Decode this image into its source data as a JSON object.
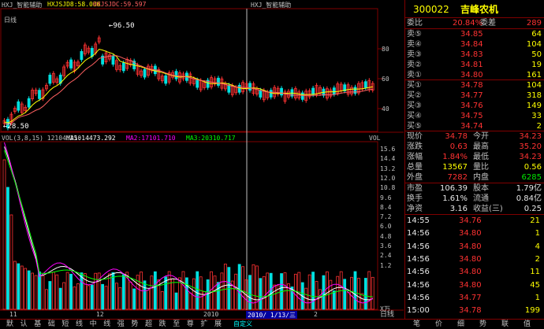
{
  "header": {
    "indicator_name": "HXJ_智能辅助",
    "line1": "HXJSJD8:58.006",
    "line2": "HXJSJDC:59.597",
    "indicator_name_right": "HXJ_智能辅助",
    "period": "日线"
  },
  "colors": {
    "up": "#ff3232",
    "down": "#00e0e0",
    "ma1": "#ffffff",
    "ma2": "#ff00ff",
    "ma3": "#00ff00",
    "grid": "#800000",
    "ma_price1": "#ffff00",
    "ma_price2": "#ff6060"
  },
  "price_chart": {
    "high_label": "96.50",
    "low_label": "28.50",
    "y_ticks": [
      "80",
      "60",
      "40"
    ],
    "cursor_date": "2010/ 1/13/三"
  },
  "volume_chart": {
    "header": "VOL(3,8,15) 12104.250",
    "ma1": "MA1:14473.292",
    "ma2": "MA2:17101.710",
    "ma3": "MA3:20310.717",
    "label_right": "VOL",
    "y_ticks": [
      "15.6",
      "14.4",
      "13.2",
      "12.0",
      "10.8",
      "9.6",
      "8.4",
      "7.2",
      "6.0",
      "4.8",
      "3.6",
      "2.4",
      "1.2"
    ],
    "unit": "X万",
    "x_labels": [
      "11",
      "12",
      "2010",
      "2"
    ],
    "custom_label": "自定义"
  },
  "quote": {
    "code": "300022",
    "name": "吉峰农机",
    "weibi_label": "委比",
    "weibi": "20.84%",
    "weicha_label": "委差",
    "weicha": "289",
    "asks": [
      {
        "label": "卖⑤",
        "price": "34.85",
        "vol": "64"
      },
      {
        "label": "卖④",
        "price": "34.84",
        "vol": "104"
      },
      {
        "label": "卖③",
        "price": "34.83",
        "vol": "50"
      },
      {
        "label": "卖②",
        "price": "34.81",
        "vol": "19"
      },
      {
        "label": "卖①",
        "price": "34.80",
        "vol": "161"
      }
    ],
    "bids": [
      {
        "label": "买①",
        "price": "34.78",
        "vol": "104"
      },
      {
        "label": "买②",
        "price": "34.77",
        "vol": "318"
      },
      {
        "label": "买③",
        "price": "34.76",
        "vol": "149"
      },
      {
        "label": "买④",
        "price": "34.75",
        "vol": "33"
      },
      {
        "label": "买⑤",
        "price": "34.74",
        "vol": "2"
      }
    ],
    "stats": [
      {
        "l1": "现价",
        "v1": "34.78",
        "l2": "今开",
        "v2": "34.23"
      },
      {
        "l1": "涨跌",
        "v1": "0.63",
        "l2": "最高",
        "v2": "35.20"
      },
      {
        "l1": "涨幅",
        "v1": "1.84%",
        "l2": "最低",
        "v2": "34.23"
      },
      {
        "l1": "总量",
        "v1": "13567",
        "l2": "量比",
        "v2": "0.56"
      },
      {
        "l1": "外盘",
        "v1": "7282",
        "l2": "内盘",
        "v2": "6285"
      }
    ],
    "fin": [
      {
        "l1": "市盈",
        "v1": "106.39",
        "l2": "股本",
        "v2": "1.79亿"
      },
      {
        "l1": "换手",
        "v1": "1.61%",
        "l2": "流通",
        "v2": "0.84亿"
      },
      {
        "l1": "净资",
        "v1": "3.16",
        "l2": "收益(三)",
        "v2": "0.25"
      }
    ],
    "ticks": [
      {
        "time": "14:55",
        "price": "34.76",
        "vol": "21"
      },
      {
        "time": "14:56",
        "price": "34.80",
        "vol": "1"
      },
      {
        "time": "14:56",
        "price": "34.80",
        "vol": "4"
      },
      {
        "time": "14:56",
        "price": "34.80",
        "vol": "2"
      },
      {
        "time": "14:56",
        "price": "34.80",
        "vol": "11"
      },
      {
        "time": "14:56",
        "price": "34.80",
        "vol": "45"
      },
      {
        "time": "14:56",
        "price": "34.77",
        "vol": "1"
      },
      {
        "time": "15:00",
        "price": "34.78",
        "vol": "199"
      }
    ]
  },
  "bottom_tabs": [
    "默",
    "认",
    "基",
    "础",
    "短",
    "线",
    "中",
    "线",
    "强",
    "势",
    "超",
    "跌",
    "至",
    "尊",
    "扩",
    "展"
  ],
  "bottom_tabs_right": [
    "笔",
    "价",
    "细",
    "势",
    "联",
    "值"
  ],
  "side_tab": "日线"
}
